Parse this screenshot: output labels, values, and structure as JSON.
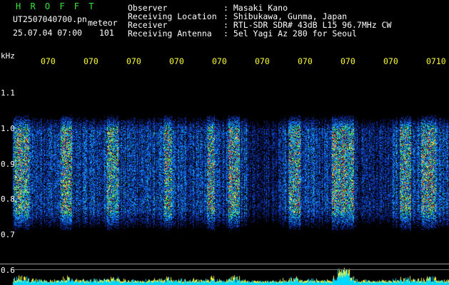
{
  "header": {
    "program_title": "H R O F F T",
    "file_name": "UT2507040700.pn",
    "mode": "meteor",
    "datetime": "25.07.04 07:00",
    "count": "101",
    "fields": [
      {
        "label": "Observer",
        "value": ": Masaki Kano"
      },
      {
        "label": "Receiving Location",
        "value": ": Shibukawa, Gunma, Japan"
      },
      {
        "label": "Receiver",
        "value": ": RTL-SDR SDR# 43dB L15 96.7MHz CW"
      },
      {
        "label": "Receiving Antenna",
        "value": ": 5el Yagi Az 280 for Seoul"
      }
    ]
  },
  "axis": {
    "unit": "kHz",
    "ticks": [
      "1.1",
      "1.0",
      "0.9",
      "0.8",
      "0.7",
      "0.6"
    ]
  },
  "time_labels": [
    "070",
    "070",
    "070",
    "070",
    "070",
    "070",
    "070",
    "070",
    "070",
    "0710"
  ],
  "colors": {
    "background": "#000000",
    "header_text": "#ffffff",
    "title": "#39e639",
    "time_labels": "#ffff33",
    "signal_low": "#0a1a8a",
    "signal_mid": "#00b4ff",
    "signal_high": "#ffff00",
    "signal_peak": "#ff2020",
    "activity_bars": "#00e0ff"
  }
}
